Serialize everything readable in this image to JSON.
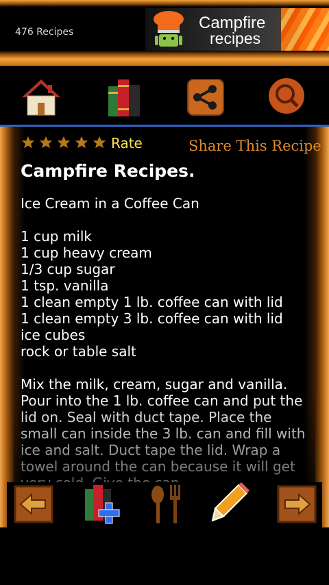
{
  "header": {
    "recipe_count": "476 Recipes",
    "banner_line1": "Campfire",
    "banner_line2": "recipes"
  },
  "toolbar": {
    "items": [
      {
        "icon": "home-icon"
      },
      {
        "icon": "books-icon"
      },
      {
        "icon": "share-icon"
      },
      {
        "icon": "search-icon"
      }
    ]
  },
  "rating": {
    "stars": 5,
    "rate_label": "Rate"
  },
  "share_label": "Share This Recipe",
  "recipe": {
    "title": "Campfire Recipes.",
    "body": "Ice Cream in a Coffee Can\n\n1 cup milk\n1 cup heavy cream\n1/3 cup sugar\n1 tsp. vanilla\n1 clean empty 1 lb. coffee can with lid\n1 clean empty 3 lb. coffee can with lid\nice cubes\nrock or table salt\n\nMix the milk, cream, sugar and vanilla. Pour into the 1 lb. coffee can and put the lid on. Seal with duct tape. Place the small can inside the 3 lb. can and fill with ice and salt. Duct tape the lid. Wrap a towel around the can because it will get very cold. Give the can"
  },
  "bottombar": {
    "items": [
      {
        "icon": "arrow-left-icon"
      },
      {
        "icon": "add-books-icon"
      },
      {
        "icon": "spoon-fork-icon"
      },
      {
        "icon": "pencil-icon"
      },
      {
        "icon": "arrow-right-icon"
      }
    ]
  },
  "colors": {
    "accent_orange": "#e08b2a",
    "rate_yellow": "#ffe54a",
    "divider_blue": "#2f63c8"
  }
}
